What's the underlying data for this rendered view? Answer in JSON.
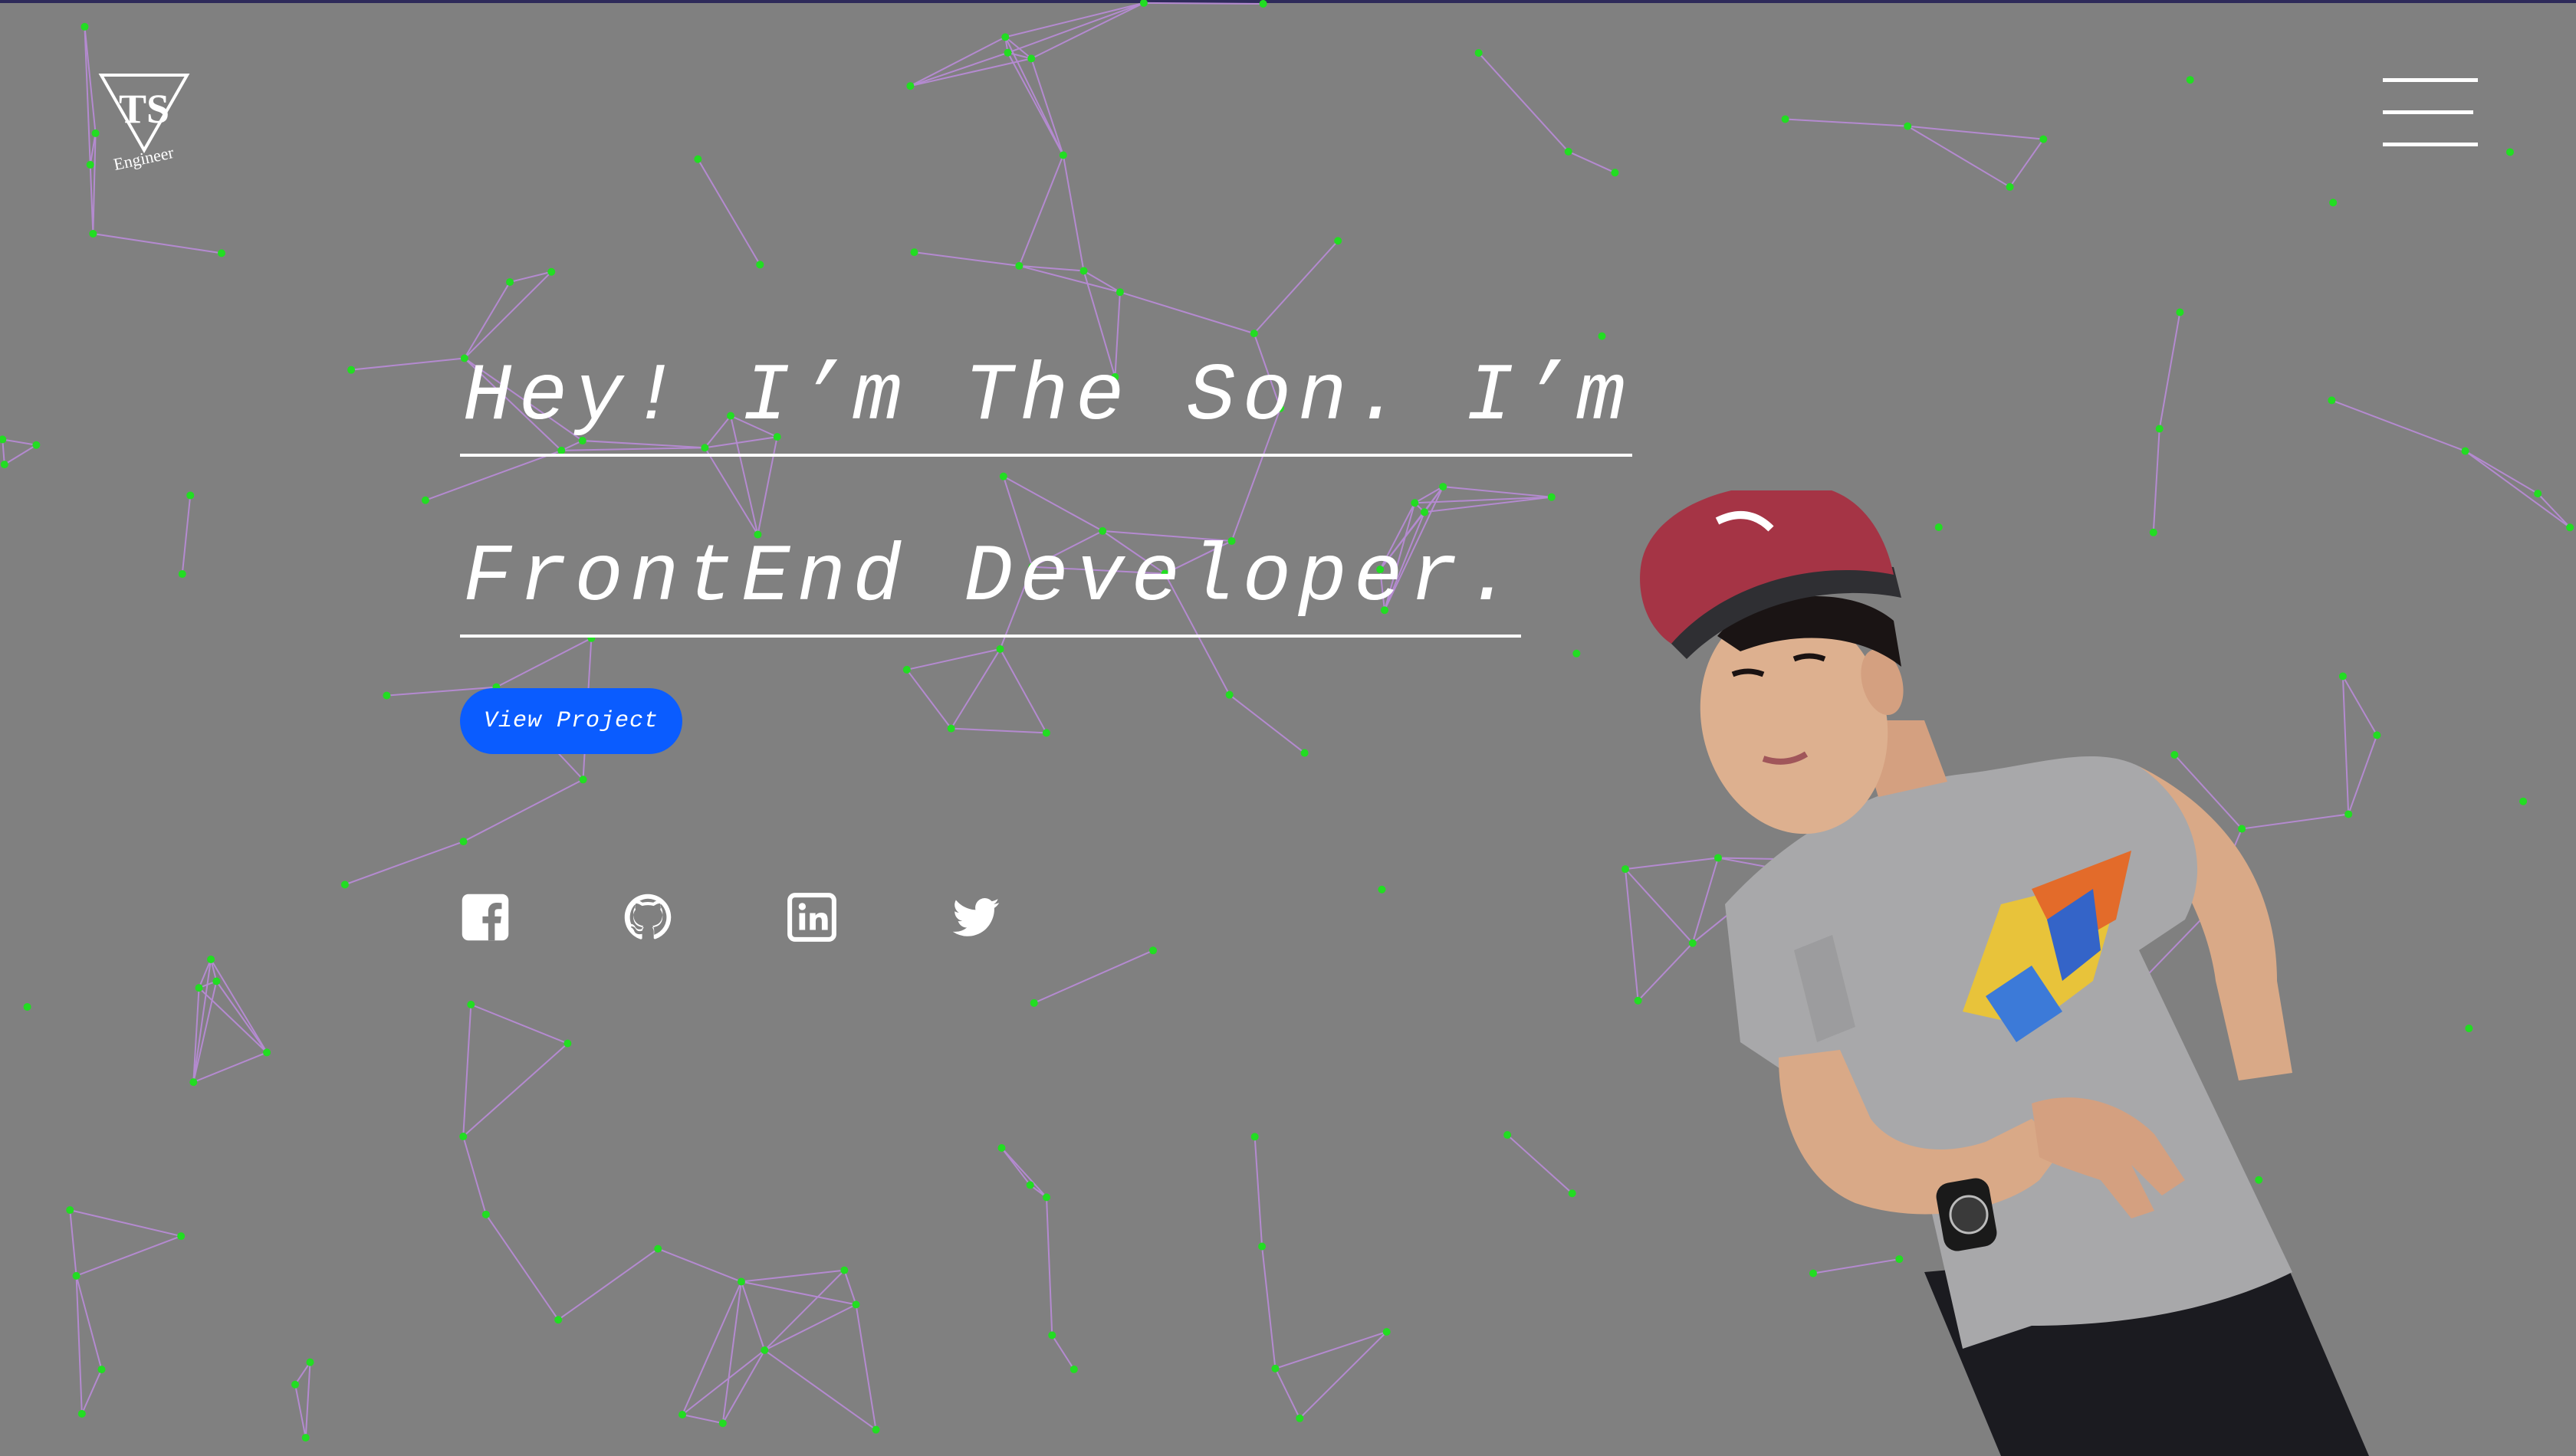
{
  "brand": {
    "logo_icon": "ts-triangle-logo",
    "logo_initials": "TS",
    "logo_caption": "Engineer"
  },
  "menu": {
    "icon": "hamburger-menu-icon"
  },
  "hero": {
    "headline_line1": "Hey! I’m The Son. I’m",
    "headline_line2": "FrontEnd Developer.",
    "cta_label": "View Project"
  },
  "social": [
    {
      "network": "facebook",
      "icon": "facebook-icon"
    },
    {
      "network": "github",
      "icon": "github-icon"
    },
    {
      "network": "linkedin",
      "icon": "linkedin-icon"
    },
    {
      "network": "twitter",
      "icon": "twitter-icon"
    }
  ],
  "colors": {
    "background": "#808080",
    "text": "#ffffff",
    "cta": "#0a5cff",
    "particle": "#22dd22",
    "particle_link": "#b48ad0"
  }
}
